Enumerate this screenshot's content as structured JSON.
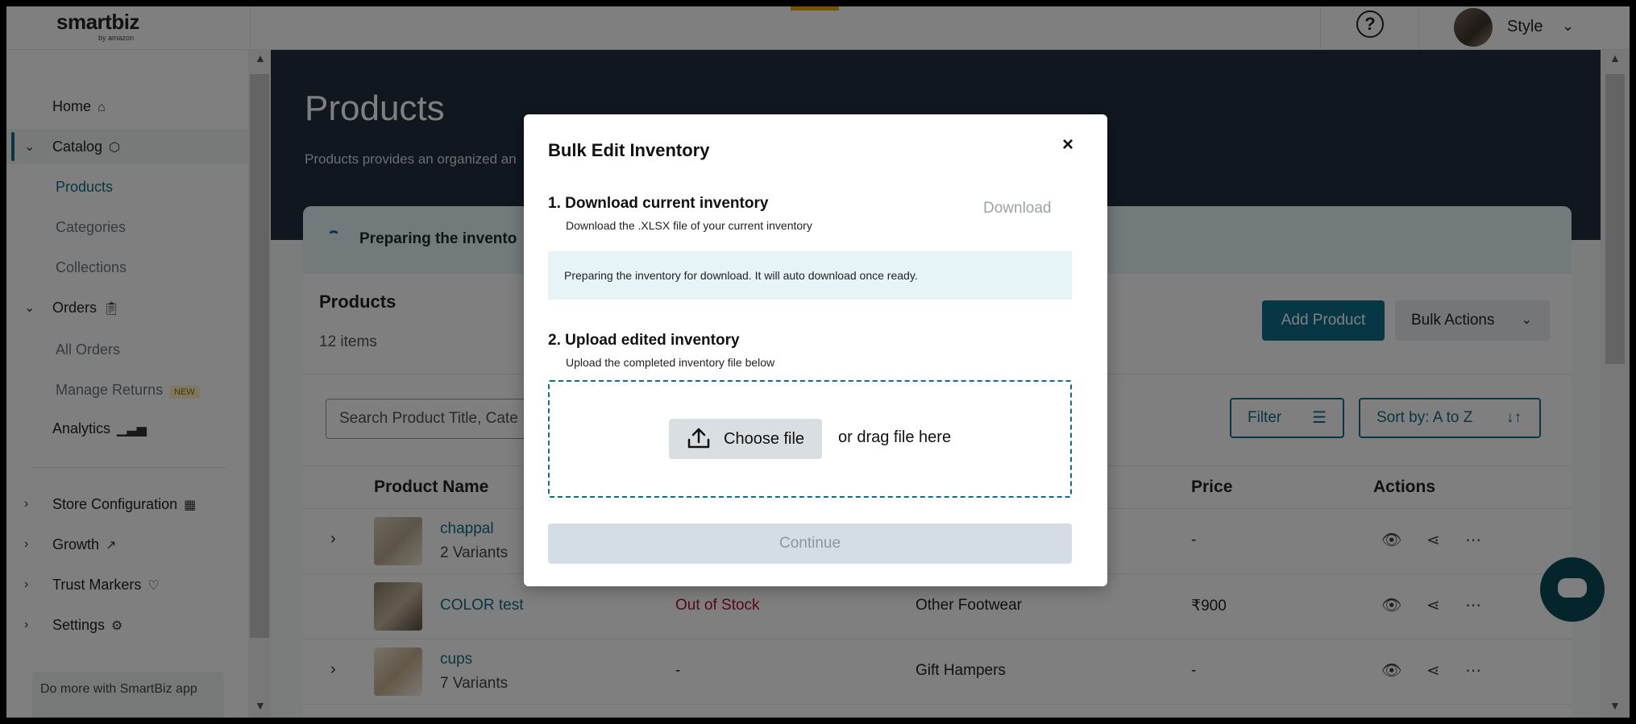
{
  "brand": {
    "logo_text": "smartbiz",
    "logo_sub": "by amazon"
  },
  "header": {
    "help_icon": "?",
    "user_name": "Style"
  },
  "sidebar": {
    "items": [
      {
        "label": "Home",
        "icon": "home-icon"
      },
      {
        "label": "Catalog",
        "icon": "box-icon"
      },
      {
        "label": "Products"
      },
      {
        "label": "Categories"
      },
      {
        "label": "Collections"
      },
      {
        "label": "Orders",
        "icon": "clipboard-icon"
      },
      {
        "label": "All Orders"
      },
      {
        "label": "Manage Returns",
        "badge": "NEW"
      },
      {
        "label": "Analytics",
        "icon": "chart-icon"
      },
      {
        "label": "Store Configuration",
        "icon": "store-icon"
      },
      {
        "label": "Growth",
        "icon": "trend-icon"
      },
      {
        "label": "Trust Markers",
        "icon": "heart-icon"
      },
      {
        "label": "Settings",
        "icon": "gear-icon"
      }
    ],
    "promo": "Do more with SmartBiz app"
  },
  "main": {
    "page_title": "Products",
    "page_desc": "Products provides an organized an",
    "banner_text": "Preparing the invento",
    "card_title": "Products",
    "item_count": "12 items",
    "add_product": "Add Product",
    "bulk_actions": "Bulk Actions",
    "search_placeholder": "Search Product Title, Cate",
    "filter": "Filter",
    "sort": "Sort by: A to Z",
    "columns": {
      "name": "Product Name",
      "price": "Price",
      "actions": "Actions"
    },
    "rows": [
      {
        "name": "chappal",
        "variants": "2 Variants",
        "stock": "",
        "category": "",
        "price": "-"
      },
      {
        "name": "COLOR test",
        "variants": "",
        "stock": "Out of Stock",
        "category": "Other Footwear",
        "price": "₹900"
      },
      {
        "name": "cups",
        "variants": "7 Variants",
        "stock": "-",
        "category": "Gift Hampers",
        "price": "-"
      }
    ]
  },
  "modal": {
    "title": "Bulk Edit Inventory",
    "close": "×",
    "step1_title": "1. Download current inventory",
    "step1_desc": "Download the .XLSX file of your current inventory",
    "download": "Download",
    "info": "Preparing the inventory for download. It will auto download once ready.",
    "step2_title": "2. Upload edited inventory",
    "step2_desc": "Upload the completed inventory file below",
    "choose_file": "Choose file",
    "drag_text": "or drag file here",
    "continue": "Continue"
  },
  "colors": {
    "accent": "#0f6e88",
    "hero": "#232f3e",
    "out_of_stock": "#b0122b"
  }
}
